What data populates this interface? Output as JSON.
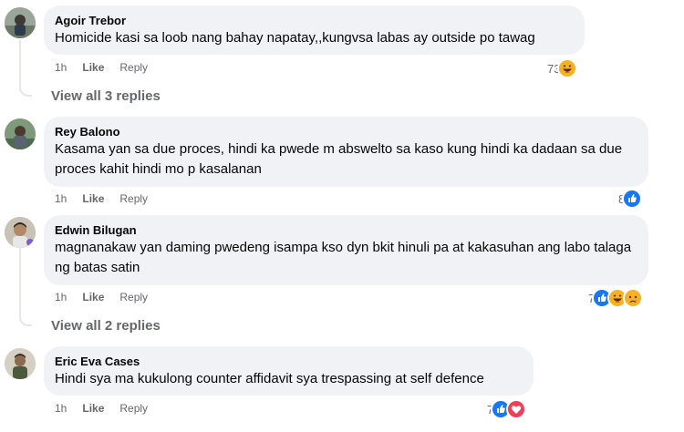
{
  "comments": [
    {
      "author": "Agoir Trebor",
      "text": "Homicide kasi sa loob nang bahay napatay,,kungvsa labas ay outside po tawag",
      "time": "1h",
      "like_label": "Like",
      "reply_label": "Reply",
      "reaction_count": "73",
      "reactions": [
        "haha-icon"
      ]
    },
    {
      "author": "Rey Balono",
      "text": "Kasama yan sa due proces, hindi ka pwede m abswelto sa kaso kung hindi ka dadaan sa due proces kahit hindi mo p kasalanan",
      "time": "1h",
      "like_label": "Like",
      "reply_label": "Reply",
      "reaction_count": "8",
      "reactions": [
        "like-icon"
      ]
    },
    {
      "author": "Edwin Bilugan",
      "text": "magnanakaw yan daming pwedeng isampa kso dyn bkit hinuli pa at kakasuhan ang labo talaga ng batas satin",
      "time": "1h",
      "like_label": "Like",
      "reply_label": "Reply",
      "reaction_count": "7",
      "reactions": [
        "like-icon",
        "haha-icon",
        "sad-icon"
      ]
    },
    {
      "author": "Eric Eva Cases",
      "text": "Hindi sya ma kukulong counter affidavit sya trespassing at self defence",
      "time": "1h",
      "like_label": "Like",
      "reply_label": "Reply",
      "reaction_count": "7",
      "reactions": [
        "like-icon",
        "love-icon"
      ]
    }
  ],
  "view_replies": [
    "View all 3 replies",
    "View all 2 replies"
  ],
  "colors": {
    "bubble": "#f0f2f5",
    "secondary_text": "#65676b",
    "like_blue": "#1877f2",
    "love_red": "#f33e58",
    "emoji_yellow": "#f7b125"
  }
}
